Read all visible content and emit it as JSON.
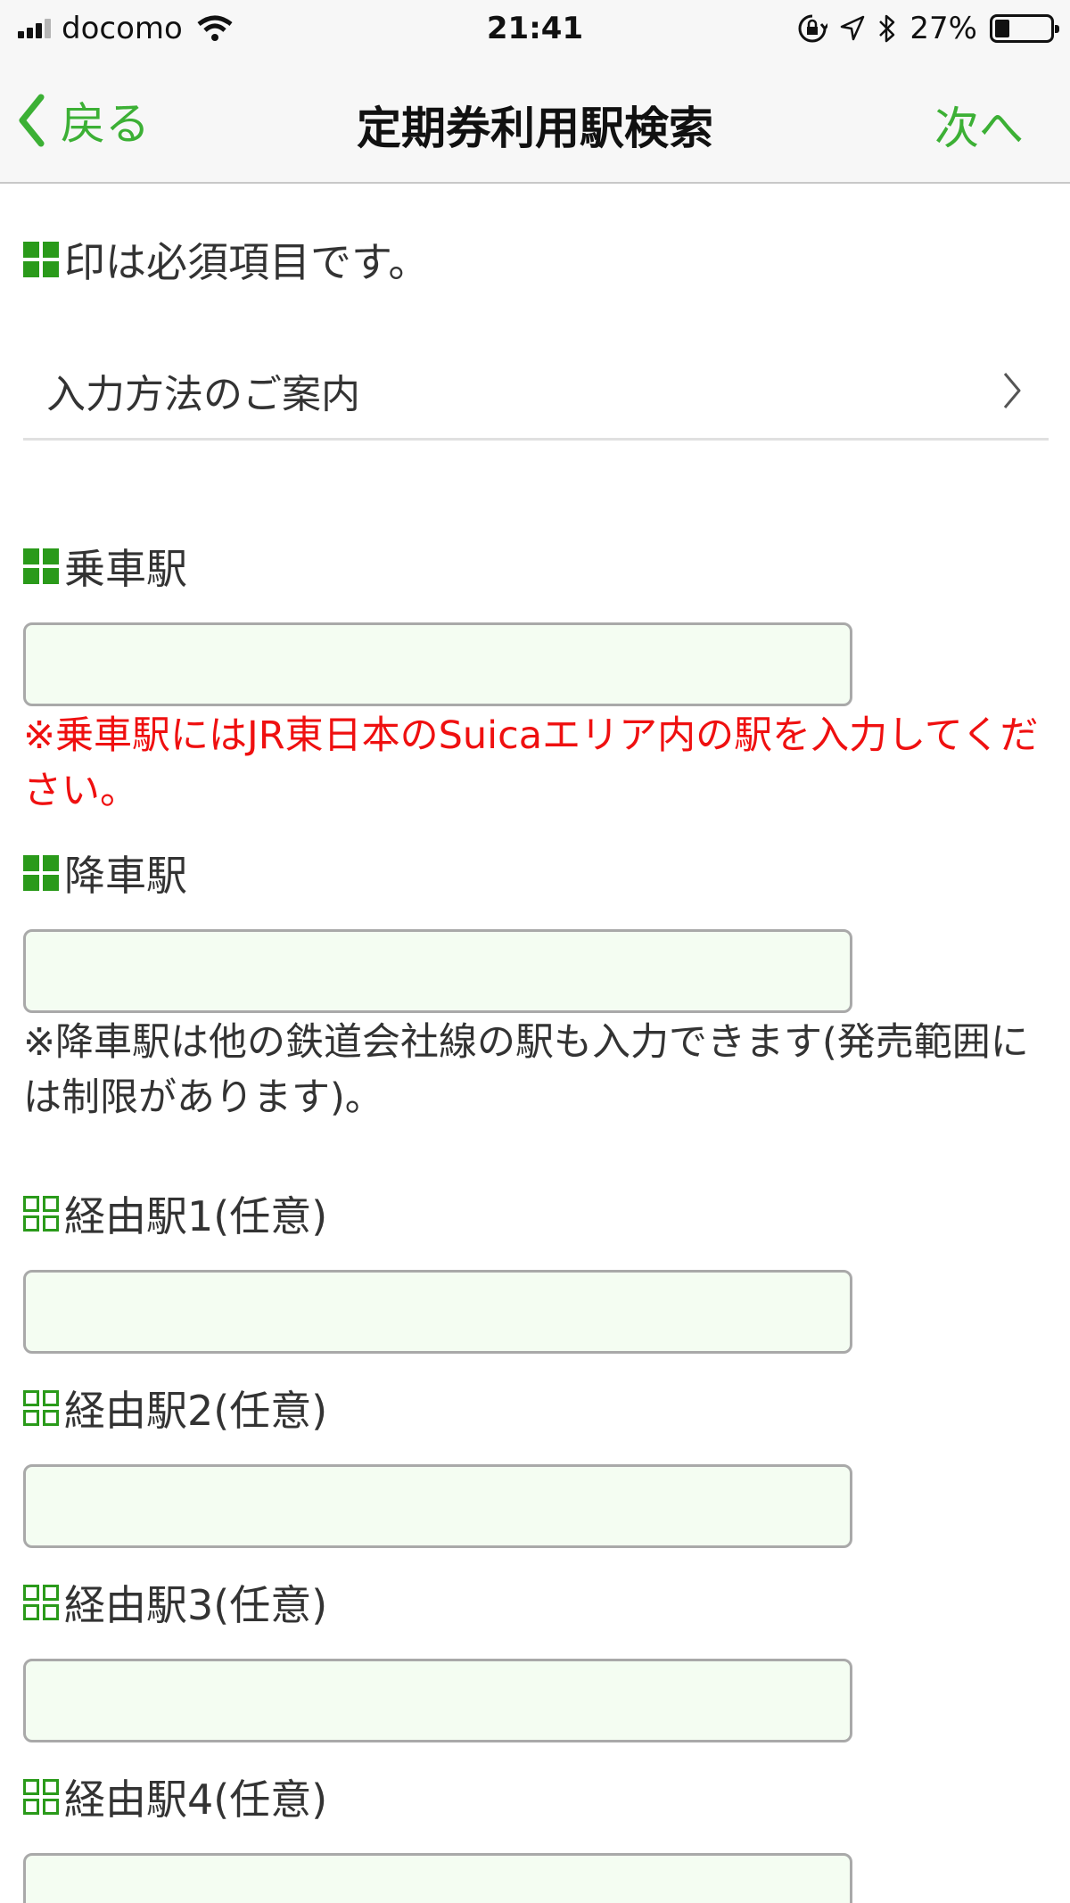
{
  "status_bar": {
    "carrier": "docomo",
    "time": "21:41",
    "battery": "27%"
  },
  "nav": {
    "back_label": "戻る",
    "title": "定期券利用駅検索",
    "next_label": "次へ"
  },
  "form": {
    "required_note": "印は必須項目です。",
    "guide_link": "入力方法のご案内",
    "boarding_label": "乗車駅",
    "boarding_value": "",
    "boarding_note": "※乗車駅にはJR東日本のSuicaエリア内の駅を入力してください。",
    "alighting_label": "降車駅",
    "alighting_value": "",
    "alighting_note": "※降車駅は他の鉄道会社線の駅も入力できます(発売範囲には制限があります)。",
    "via_fields": [
      {
        "label": "経由駅1(任意)",
        "value": ""
      },
      {
        "label": "経由駅2(任意)",
        "value": ""
      },
      {
        "label": "経由駅3(任意)",
        "value": ""
      },
      {
        "label": "経由駅4(任意)",
        "value": ""
      }
    ]
  },
  "colors": {
    "accent_green": "#3cb035",
    "mark_green": "#2a9a1a",
    "warning_red": "#ef1010",
    "field_bg": "#f4fdf2"
  }
}
